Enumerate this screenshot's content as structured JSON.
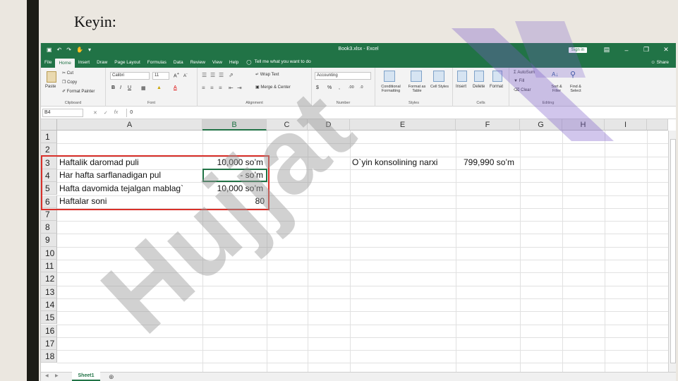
{
  "slide": {
    "title": "Keyin:"
  },
  "watermark": {
    "text": "Hujjat"
  },
  "window": {
    "title": "Book3.xlsx - Excel",
    "signin": "Sign in",
    "share": "Share",
    "tabs": [
      "File",
      "Home",
      "Insert",
      "Draw",
      "Page Layout",
      "Formulas",
      "Data",
      "Review",
      "View",
      "Help"
    ],
    "tell_me": "Tell me what you want to do"
  },
  "ribbon": {
    "clipboard": {
      "paste": "Paste",
      "cut": "Cut",
      "copy": "Copy",
      "format_painter": "Format Painter",
      "label": "Clipboard"
    },
    "font": {
      "name": "Calibri",
      "size": "11",
      "label": "Font"
    },
    "alignment": {
      "wrap": "Wrap Text",
      "merge": "Merge & Center",
      "label": "Alignment"
    },
    "number": {
      "format": "Accounting",
      "label": "Number"
    },
    "styles": {
      "conditional": "Conditional Formatting",
      "format_table": "Format as Table",
      "cell_styles": "Cell Styles",
      "label": "Styles"
    },
    "cells": {
      "insert": "Insert",
      "delete": "Delete",
      "format": "Format",
      "label": "Cells"
    },
    "editing": {
      "autosum": "AutoSum",
      "fill": "Fill",
      "clear": "Clear",
      "sort": "Sort & Filter",
      "find": "Find & Select",
      "label": "Editing"
    }
  },
  "formula_bar": {
    "name_box": "B4",
    "value": "0"
  },
  "columns": [
    "A",
    "B",
    "C",
    "D",
    "E",
    "F",
    "G",
    "H",
    "I"
  ],
  "rows": [
    "1",
    "2",
    "3",
    "4",
    "5",
    "6",
    "7",
    "8",
    "9",
    "10",
    "11",
    "12",
    "13",
    "14",
    "15",
    "16",
    "17",
    "18"
  ],
  "cells": {
    "A3": "Haftalik daromad puli",
    "B3": "10,000 so’m",
    "A4": "Har hafta sarflanadigan pul",
    "B4": "- so’m",
    "A5": "Hafta davomida tejalgan mablag`",
    "B5": "10,000 so’m",
    "A6": "Haftalar soni",
    "B6": "80",
    "E3": "O`yin konsolining narxi",
    "F3": "799,990 so’m"
  },
  "sheets": [
    "Sheet1"
  ],
  "colors": {
    "excel_green": "#217346",
    "highlight_red": "#d9302a",
    "watermark": "#7b5cc9"
  }
}
